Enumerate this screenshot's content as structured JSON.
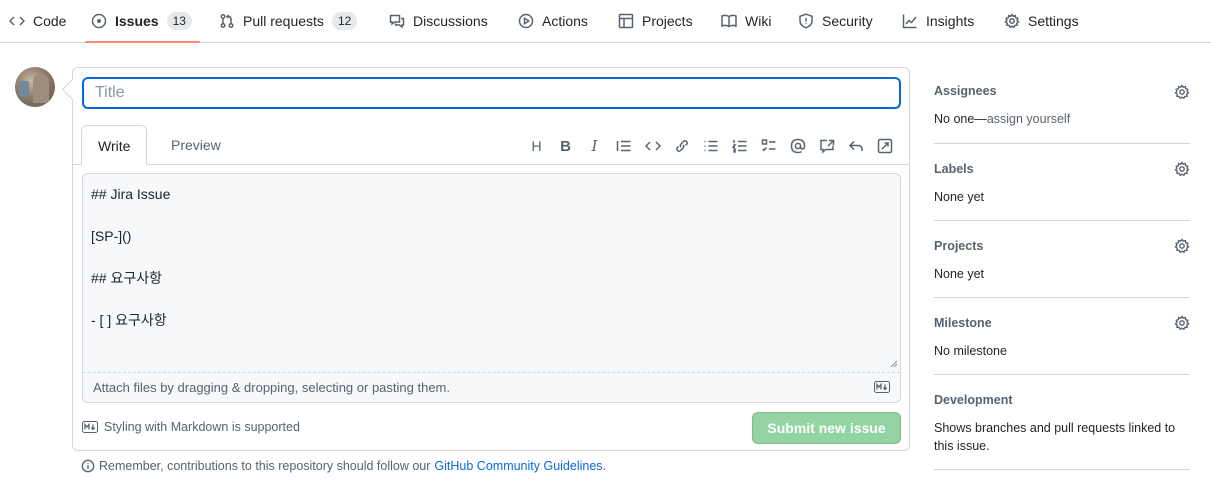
{
  "nav": {
    "items": [
      {
        "label": "Code",
        "icon": "code-icon"
      },
      {
        "label": "Issues",
        "icon": "issue-opened-icon",
        "count": "13",
        "selected": true
      },
      {
        "label": "Pull requests",
        "icon": "pull-request-icon",
        "count": "12"
      },
      {
        "label": "Discussions",
        "icon": "discussions-icon"
      },
      {
        "label": "Actions",
        "icon": "play-icon"
      },
      {
        "label": "Projects",
        "icon": "table-icon"
      },
      {
        "label": "Wiki",
        "icon": "book-icon"
      },
      {
        "label": "Security",
        "icon": "shield-icon"
      },
      {
        "label": "Insights",
        "icon": "graph-icon"
      },
      {
        "label": "Settings",
        "icon": "gear-icon"
      }
    ],
    "selected_color": "#fd8c73"
  },
  "form": {
    "title_placeholder": "Title",
    "tabs": {
      "write": "Write",
      "preview": "Preview"
    },
    "toolbar": [
      "heading-icon",
      "bold-icon",
      "italic-icon",
      "quote-icon",
      "code-icon",
      "link-icon",
      "unordered-list-icon",
      "ordered-list-icon",
      "task-list-icon",
      "mention-icon",
      "cross-reference-icon",
      "reply-icon",
      "fullscreen-icon"
    ],
    "body": "## Jira Issue\n\n[SP-]()\n\n## 요구사항\n\n- [ ] 요구사항",
    "attach_text": "Attach files by dragging & dropping, selecting or pasting them.",
    "markdown_note": "Styling with Markdown is supported",
    "submit_label": "Submit new issue",
    "submit_color": "#94d3a2",
    "guidelines_prefix": "Remember, contributions to this repository should follow our",
    "guidelines_link": "GitHub Community Guidelines",
    "guidelines_suffix": "."
  },
  "sidebar": {
    "assignees": {
      "heading": "Assignees",
      "value_prefix": "No one—",
      "value_link": "assign yourself"
    },
    "labels": {
      "heading": "Labels",
      "value": "None yet"
    },
    "projects": {
      "heading": "Projects",
      "value": "None yet"
    },
    "milestone": {
      "heading": "Milestone",
      "value": "No milestone"
    },
    "development": {
      "heading": "Development",
      "value": "Shows branches and pull requests linked to this issue."
    }
  }
}
